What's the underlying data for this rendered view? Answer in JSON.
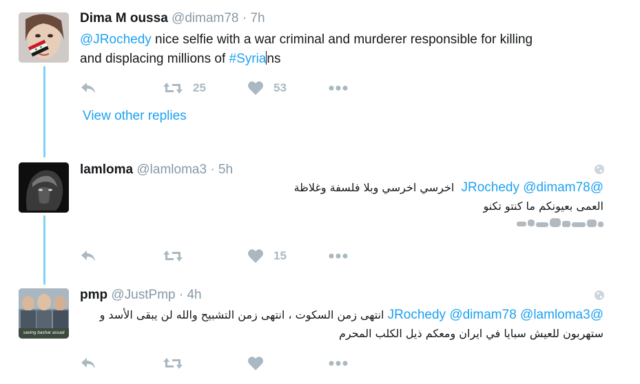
{
  "tweets": [
    {
      "author": "Dima M oussa",
      "handle": "@dimam78",
      "separator": "·",
      "time": "7h",
      "mention": "@JRochedy",
      "text_line1": " nice selfie with a war criminal and murderer responsible for killing",
      "text_line2_start": "and displacing millions of ",
      "hashtag": "#Syria",
      "text_line2_end": "ns",
      "retweets": "25",
      "likes": "53"
    },
    {
      "author": "lamloma",
      "handle": "@lamloma3",
      "separator": "·",
      "time": "5h",
      "mentions": "@JRochedy @dimam78",
      "text_line1": "اخرسي اخرسي وبلا فلسفة وغلاظة",
      "text_line2": "العمى بعيونكم ما كنتو تكنو",
      "retweets": "",
      "likes": "15"
    },
    {
      "author": "pmp",
      "handle": "@JustPmp",
      "separator": "·",
      "time": "4h",
      "mentions": "@JRochedy @dimam78 @lamloma3",
      "text_line1": "انتهى زمن السكوت ، انتهى زمن التشبيح والله لن يبقى الأسد و",
      "text_line2": "ستهربون للعيش سبايا في ايران ومعكم ذيل الكلب المحرم",
      "avatar_caption": "saving bashar assad",
      "retweets": "",
      "likes": ""
    }
  ],
  "view_other_replies": "View other replies",
  "colors": {
    "link": "#1da1f2",
    "thread_line": "#7fd3f5",
    "muted": "#8899a6",
    "action_icon": "#aab8c2"
  },
  "icons": [
    "reply-icon",
    "retweet-icon",
    "like-icon",
    "more-icon",
    "globe-icon"
  ]
}
